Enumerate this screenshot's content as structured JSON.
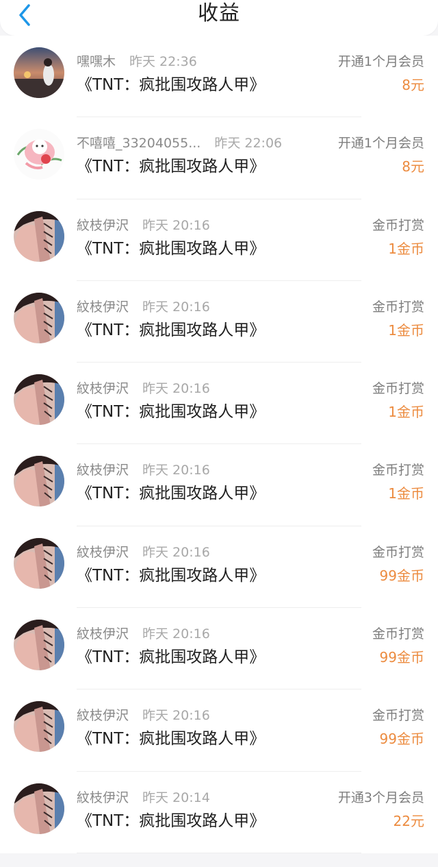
{
  "header": {
    "title": "收益"
  },
  "colors": {
    "accent": "#1e97e8",
    "amount": "#ec8b3f"
  },
  "items": [
    {
      "user": "嘿嘿木",
      "time": "昨天 22:36",
      "type": "开通1个月会员",
      "book": "《TNT：疯批围攻路人甲》",
      "amount": "8元",
      "avatar": "sunset-avatar"
    },
    {
      "user": "不嘻嘻_33204055...",
      "time": "昨天 22:06",
      "type": "开通1个月会员",
      "book": "《TNT：疯批围攻路人甲》",
      "amount": "8元",
      "avatar": "cartoon-avatar"
    },
    {
      "user": "紋枝伊沢",
      "time": "昨天 20:16",
      "type": "金币打赏",
      "book": "《TNT：疯批围攻路人甲》",
      "amount": "1金币",
      "avatar": "portrait-avatar"
    },
    {
      "user": "紋枝伊沢",
      "time": "昨天 20:16",
      "type": "金币打赏",
      "book": "《TNT：疯批围攻路人甲》",
      "amount": "1金币",
      "avatar": "portrait-avatar"
    },
    {
      "user": "紋枝伊沢",
      "time": "昨天 20:16",
      "type": "金币打赏",
      "book": "《TNT：疯批围攻路人甲》",
      "amount": "1金币",
      "avatar": "portrait-avatar"
    },
    {
      "user": "紋枝伊沢",
      "time": "昨天 20:16",
      "type": "金币打赏",
      "book": "《TNT：疯批围攻路人甲》",
      "amount": "1金币",
      "avatar": "portrait-avatar"
    },
    {
      "user": "紋枝伊沢",
      "time": "昨天 20:16",
      "type": "金币打赏",
      "book": "《TNT：疯批围攻路人甲》",
      "amount": "99金币",
      "avatar": "portrait-avatar"
    },
    {
      "user": "紋枝伊沢",
      "time": "昨天 20:16",
      "type": "金币打赏",
      "book": "《TNT：疯批围攻路人甲》",
      "amount": "99金币",
      "avatar": "portrait-avatar"
    },
    {
      "user": "紋枝伊沢",
      "time": "昨天 20:16",
      "type": "金币打赏",
      "book": "《TNT：疯批围攻路人甲》",
      "amount": "99金币",
      "avatar": "portrait-avatar"
    },
    {
      "user": "紋枝伊沢",
      "time": "昨天 20:14",
      "type": "开通3个月会员",
      "book": "《TNT：疯批围攻路人甲》",
      "amount": "22元",
      "avatar": "portrait-avatar"
    }
  ]
}
